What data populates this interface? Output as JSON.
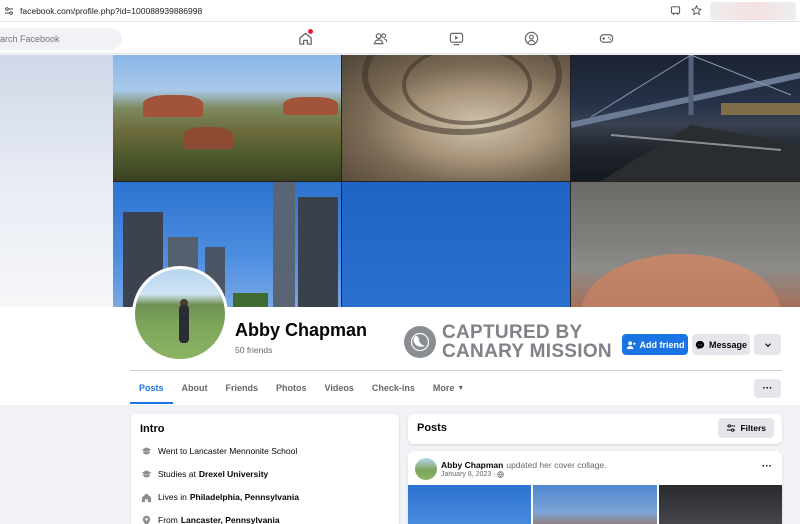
{
  "browser": {
    "url": "facebook.com/profile.php?id=100088939886998",
    "icons": [
      "tune-icon",
      "cast-icon",
      "star-icon"
    ]
  },
  "nav": {
    "search_placeholder": "Search Facebook",
    "search_display": "arch Facebook",
    "icons": [
      "home-icon",
      "friends-icon",
      "watch-icon",
      "groups-icon",
      "gaming-icon"
    ],
    "accent": "#1b74e4",
    "notification_color": "#e41e3f"
  },
  "profile": {
    "name": "Abby Chapman",
    "friends": "50 friends",
    "watermark_line1": "CAPTURED BY",
    "watermark_line2": "CANARY MISSION",
    "add_friend": "Add friend",
    "message": "Message"
  },
  "tabs": [
    {
      "label": "Posts",
      "active": true
    },
    {
      "label": "About"
    },
    {
      "label": "Friends"
    },
    {
      "label": "Photos"
    },
    {
      "label": "Videos"
    },
    {
      "label": "Check-ins"
    },
    {
      "label": "More"
    }
  ],
  "intro": {
    "title": "Intro",
    "items": [
      {
        "icon": "school-icon",
        "prefix": "Went to Lancaster Mennonite School",
        "bold": ""
      },
      {
        "icon": "school-icon",
        "prefix": "Studies at",
        "bold": "Drexel University"
      },
      {
        "icon": "home-icon",
        "prefix": "Lives in",
        "bold": "Philadelphia, Pennsylvania"
      },
      {
        "icon": "location-icon",
        "prefix": "From",
        "bold": "Lancaster, Pennsylvania"
      }
    ]
  },
  "posts": {
    "title": "Posts",
    "filters": "Filters",
    "post": {
      "author": "Abby Chapman",
      "action": "updated her cover collage.",
      "date": "January 8, 2023 ·"
    }
  }
}
